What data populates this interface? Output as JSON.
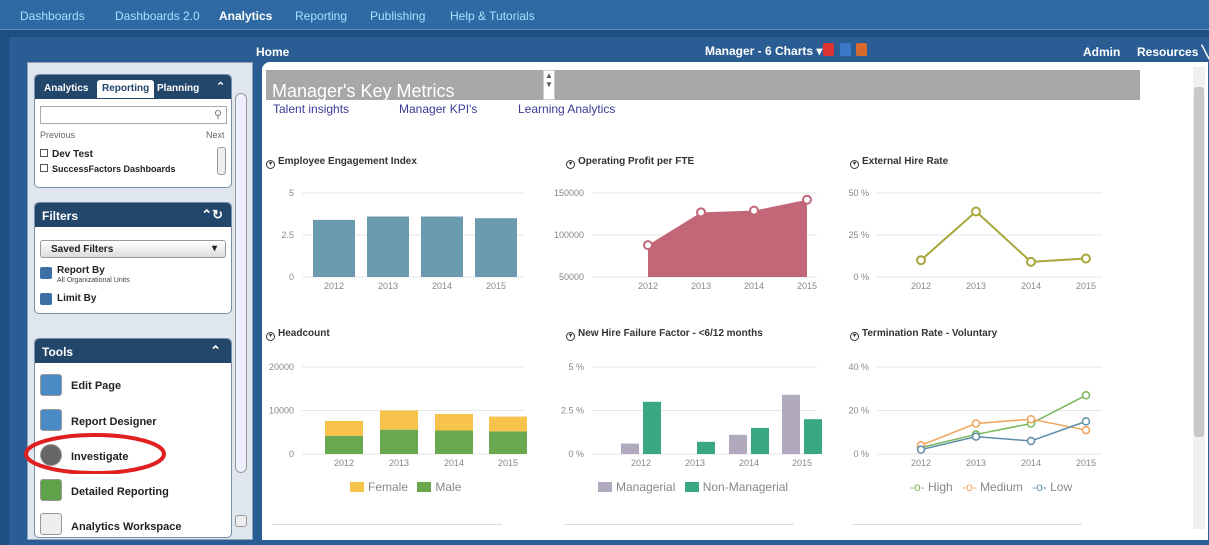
{
  "topnav": [
    "Dashboards",
    "Dashboards 2.0",
    "Analytics",
    "Reporting",
    "Publishing",
    "Help & Tutorials"
  ],
  "header": {
    "home": "Home",
    "charts_menu": "Manager - 6 Charts ▾",
    "admin": "Admin",
    "resources": "Resources ╲"
  },
  "colors": {
    "teal": "#6b9bae",
    "rose": "#c26777",
    "olive": "#a9a63a",
    "female": "#f8c34a",
    "male": "#6aa84f",
    "managerial": "#b1a9bd",
    "nonmanagerial": "#3aa784",
    "high": "#79b75c",
    "medium": "#f1a35a",
    "low": "#5e8fa9",
    "accent": "#23466b",
    "highlight": "#e02020"
  },
  "left": {
    "tabs": [
      "Analytics",
      "Reporting",
      "Planning"
    ],
    "search_placeholder": "",
    "previous": "Previous",
    "next": "Next",
    "items": [
      "Dev Test",
      "SuccessFactors Dashboards"
    ],
    "filters_title": "Filters",
    "saved_filters": "Saved Filters",
    "report_by": "Report By",
    "report_by_sub": "All Organizational Units",
    "limit_by": "Limit By",
    "tools_title": "Tools",
    "tools": [
      "Edit Page",
      "Report Designer",
      "Investigate",
      "Detailed Reporting",
      "Analytics Workspace"
    ]
  },
  "content": {
    "page_title": "Manager's Key Metrics",
    "links": [
      "Talent insights",
      "Manager KPI's",
      "Learning Analytics"
    ],
    "legends": {
      "headcount": [
        "Female",
        "Male"
      ],
      "nhff": [
        "Managerial",
        "Non-Managerial"
      ],
      "term": [
        "High",
        "Medium",
        "Low"
      ]
    }
  },
  "chart_data": [
    {
      "type": "bar",
      "title": "Employee Engagement Index",
      "categories": [
        "2012",
        "2013",
        "2014",
        "2015"
      ],
      "values": [
        3.4,
        3.6,
        3.6,
        3.5
      ],
      "ylim": [
        0,
        5
      ],
      "yticks": [
        "0",
        "2.5",
        "5"
      ]
    },
    {
      "type": "area",
      "title": "Operating Profit per FTE",
      "categories": [
        "2012",
        "2013",
        "2014",
        "2015"
      ],
      "values": [
        88000,
        127000,
        129000,
        142000
      ],
      "ylim": [
        50000,
        150000
      ],
      "yticks": [
        "50000",
        "100000",
        "150000"
      ]
    },
    {
      "type": "line",
      "title": "External Hire Rate",
      "categories": [
        "2012",
        "2013",
        "2014",
        "2015"
      ],
      "values": [
        10,
        39,
        9,
        11
      ],
      "ylim": [
        0,
        50
      ],
      "yticks": [
        "0 %",
        "25 %",
        "50 %"
      ]
    },
    {
      "type": "bar",
      "title": "Headcount",
      "categories": [
        "2012",
        "2013",
        "2014",
        "2015"
      ],
      "series": [
        {
          "name": "Male",
          "values": [
            4200,
            5600,
            5400,
            5200
          ]
        },
        {
          "name": "Female",
          "values": [
            3400,
            4400,
            3800,
            3400
          ]
        }
      ],
      "ylim": [
        0,
        20000
      ],
      "yticks": [
        "0",
        "10000",
        "20000"
      ]
    },
    {
      "type": "bar",
      "title": "New Hire Failure Factor - <6/12 months",
      "categories": [
        "2012",
        "2013",
        "2014",
        "2015"
      ],
      "series": [
        {
          "name": "Managerial",
          "values": [
            0.6,
            0.0,
            1.1,
            3.4
          ]
        },
        {
          "name": "Non-Managerial",
          "values": [
            3.0,
            0.7,
            1.5,
            2.0
          ]
        }
      ],
      "ylim": [
        0,
        5
      ],
      "yticks": [
        "0 %",
        "2.5 %",
        "5 %"
      ]
    },
    {
      "type": "line",
      "title": "Termination Rate - Voluntary",
      "categories": [
        "2012",
        "2013",
        "2014",
        "2015"
      ],
      "series": [
        {
          "name": "High",
          "values": [
            3,
            9,
            14,
            27
          ]
        },
        {
          "name": "Medium",
          "values": [
            4,
            14,
            16,
            11
          ]
        },
        {
          "name": "Low",
          "values": [
            2,
            8,
            6,
            15
          ]
        }
      ],
      "ylim": [
        0,
        40
      ],
      "yticks": [
        "0 %",
        "20 %",
        "40 %"
      ]
    }
  ]
}
